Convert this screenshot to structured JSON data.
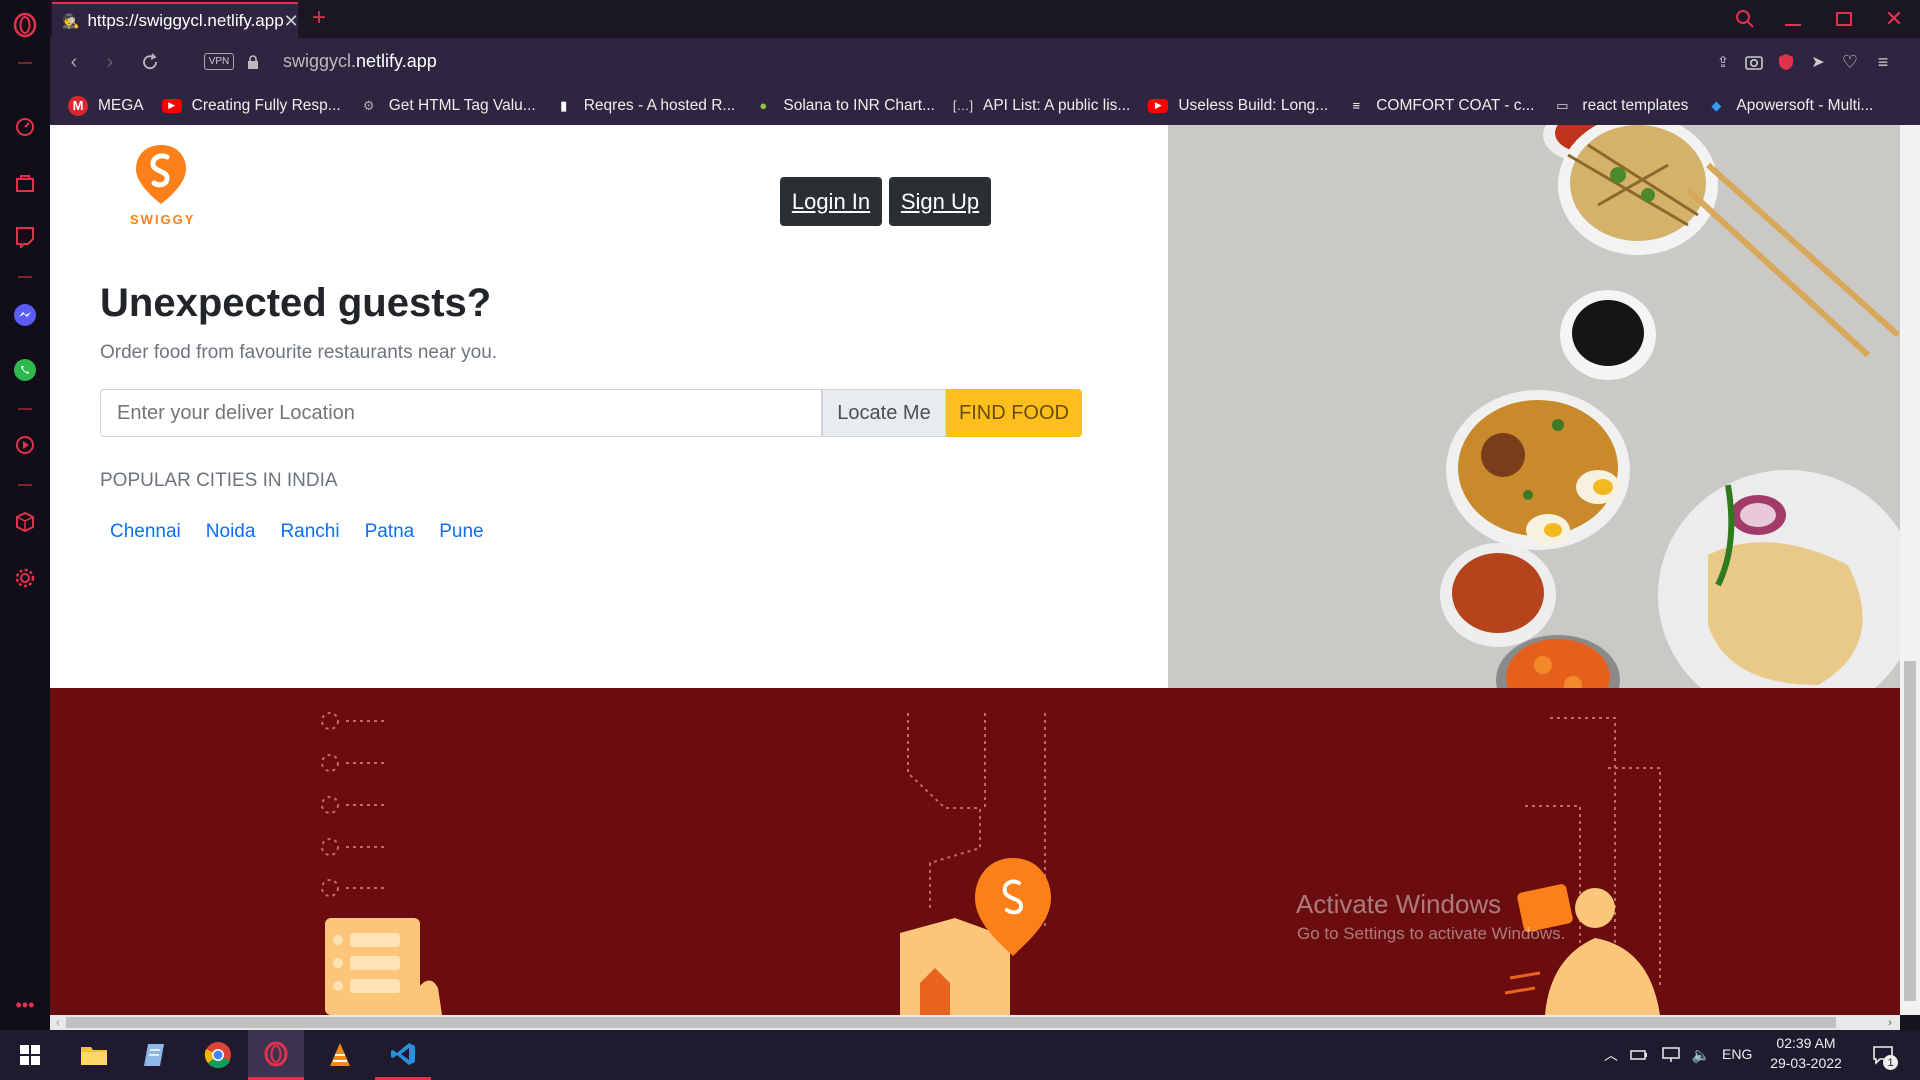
{
  "browser": {
    "tab_title": "https://swiggycl.netlify.app",
    "url_host_part1": "swiggycl.",
    "url_host_part2": "netlify.app",
    "vpn_label": "VPN"
  },
  "bookmarks": [
    {
      "label": "MEGA",
      "icon": "mega-icon",
      "color": "#d9272e"
    },
    {
      "label": "Creating Fully Resp...",
      "icon": "youtube-icon",
      "color": "#ff0000"
    },
    {
      "label": "Get HTML Tag Valu...",
      "icon": "gear-user-icon",
      "color": "#aaaaaa"
    },
    {
      "label": "Reqres - A hosted R...",
      "icon": "document-icon",
      "color": "#ffffff"
    },
    {
      "label": "Solana to INR Chart...",
      "icon": "coin-icon",
      "color": "#8bc34a"
    },
    {
      "label": "API List: A public lis...",
      "icon": "brackets-icon",
      "color": "#dddddd"
    },
    {
      "label": "Useless Build: Long...",
      "icon": "youtube-icon",
      "color": "#ff0000"
    },
    {
      "label": "COMFORT COAT - c...",
      "icon": "comfort-logo-icon",
      "color": "#ffffff"
    },
    {
      "label": "react templates",
      "icon": "folder-icon",
      "color": "#dddddd"
    },
    {
      "label": "Apowersoft - Multi...",
      "icon": "apowersoft-icon",
      "color": "#3b9cff"
    }
  ],
  "site": {
    "logo_text": "SWIGGY",
    "login_label": "Login In",
    "signup_label": "Sign Up",
    "headline": "Unexpected guests?",
    "subheadline": "Order food from favourite restaurants near you.",
    "location_placeholder": "Enter your deliver Location",
    "locate_label": "Locate Me",
    "find_label": "FIND FOOD",
    "popular_heading": "POPULAR CITIES IN INDIA",
    "cities": [
      "Chennai",
      "Noida",
      "Ranchi",
      "Patna",
      "Pune"
    ],
    "accent": "#fc8019",
    "find_bg": "#fcbf1e"
  },
  "watermark": {
    "title": "Activate Windows",
    "subtitle": "Go to Settings to activate Windows."
  },
  "taskbar": {
    "language": "ENG",
    "time": "02:39 AM",
    "date": "29-03-2022",
    "notifications": "1"
  }
}
